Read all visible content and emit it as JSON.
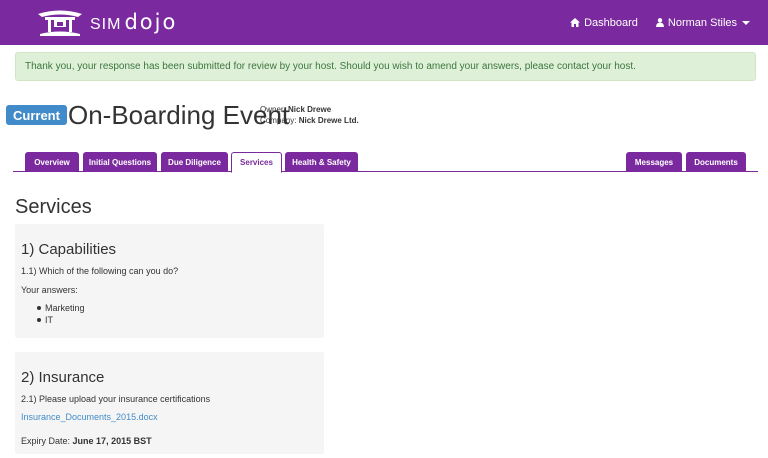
{
  "brand": {
    "sim": "SIM",
    "dojo": "dojo"
  },
  "nav": {
    "dashboard": "Dashboard",
    "user": "Norman Stiles"
  },
  "alert": {
    "message": "Thank you, your response has been submitted for review by your host. Should you wish to amend your answers, please contact your host."
  },
  "event": {
    "status": "Current",
    "title": "On-Boarding Event",
    "owner_label": "Owner:",
    "owner": "Nick Drewe",
    "company_label": "Company:",
    "company": "Nick Drewe Ltd."
  },
  "tabs": {
    "left": [
      "Overview",
      "Initial Questions",
      "Due Diligence",
      "Services",
      "Health & Safety"
    ],
    "right": [
      "Messages",
      "Documents"
    ],
    "active": "Services"
  },
  "main": {
    "heading": "Services",
    "sections": [
      {
        "title": "1) Capabilities",
        "question": "1.1) Which of the following can you do?",
        "answers_label": "Your answers:",
        "answers": [
          "Marketing",
          "IT"
        ]
      },
      {
        "title": "2) Insurance",
        "question": "2.1) Please upload your insurance certifications",
        "file": "Insurance_Documents_2015.docx",
        "expiry_label": "Expiry Date:",
        "expiry_value": "June 17, 2015 BST"
      }
    ]
  },
  "colors": {
    "brand": "#7a2a9e",
    "badge": "#428bca",
    "alert_bg": "#dff0d8",
    "alert_text": "#3c763d",
    "card_bg": "#f5f5f5"
  },
  "icons": {
    "logo": "pagoda-icon",
    "dashboard": "home-icon",
    "user": "user-icon",
    "dropdown": "caret-down-icon"
  }
}
